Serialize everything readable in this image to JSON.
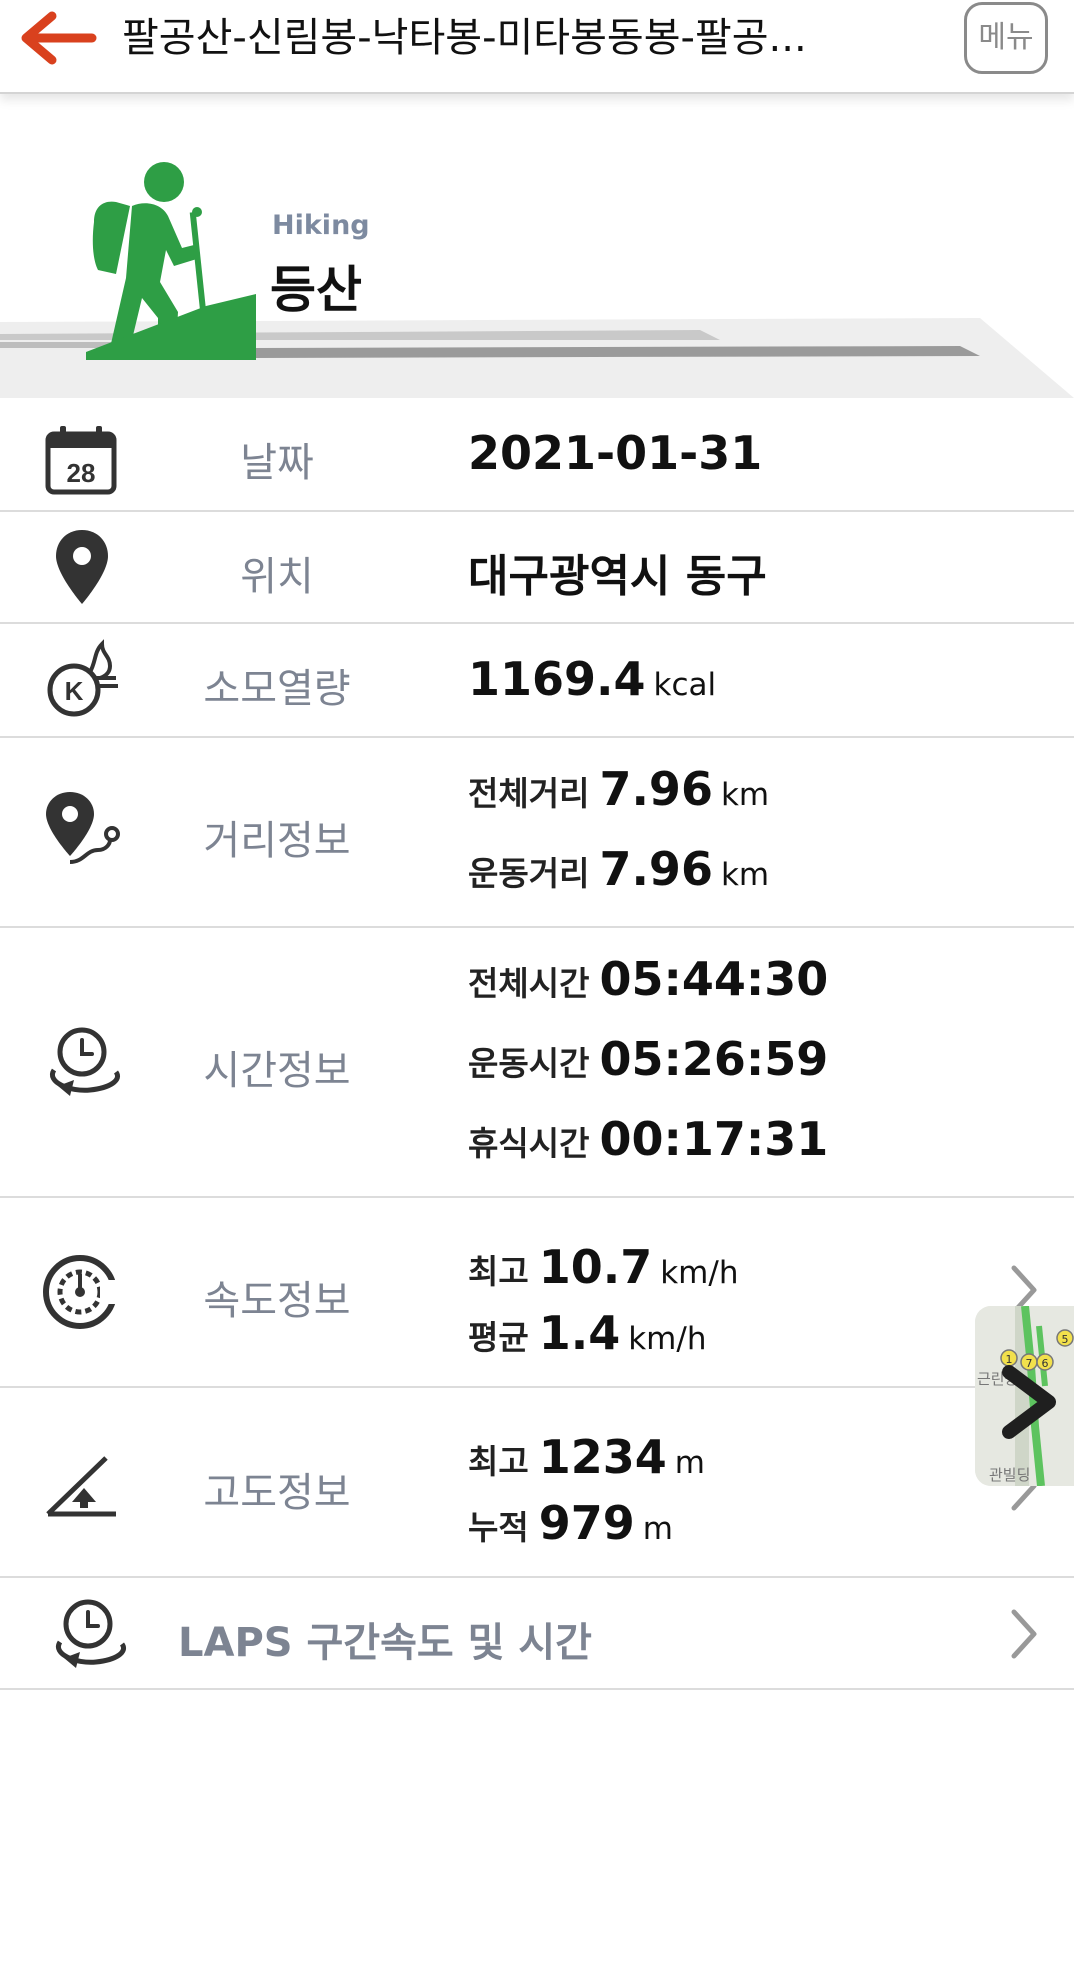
{
  "header": {
    "title": "팔공산-신림봉-낙타봉-미타봉동봉-팔공...",
    "menu_label": "메뉴"
  },
  "activity": {
    "name_en": "Hiking",
    "name_ko": "등산"
  },
  "rows": {
    "date": {
      "label": "날짜",
      "value": "2021-01-31",
      "calendar_day": "28"
    },
    "location": {
      "label": "위치",
      "value": "대구광역시 동구"
    },
    "calories": {
      "label": "소모열량",
      "value": "1169.4",
      "unit": "kcal",
      "icon_letter": "K"
    },
    "distance": {
      "label": "거리정보",
      "total_label": "전체거리",
      "total_value": "7.96",
      "total_unit": "km",
      "moving_label": "운동거리",
      "moving_value": "7.96",
      "moving_unit": "km"
    },
    "time": {
      "label": "시간정보",
      "total_label": "전체시간",
      "total_value": "05:44:30",
      "moving_label": "운동시간",
      "moving_value": "05:26:59",
      "rest_label": "휴식시간",
      "rest_value": "00:17:31"
    },
    "speed": {
      "label": "속도정보",
      "max_label": "최고",
      "max_value": "10.7",
      "max_unit": "km/h",
      "avg_label": "평균",
      "avg_value": "1.4",
      "avg_unit": "km/h"
    },
    "altitude": {
      "label": "고도정보",
      "max_label": "최고",
      "max_value": "1234",
      "max_unit": "m",
      "cum_label": "누적",
      "cum_value": "979",
      "cum_unit": "m"
    },
    "laps": {
      "label": "LAPS 구간속도 및 시간"
    }
  },
  "map_thumb": {
    "text_top": "근린공",
    "text_bottom": "관빌딩",
    "markers": [
      "1",
      "7",
      "6",
      "5"
    ]
  },
  "colors": {
    "accent_back": "#d9411e",
    "hiker_green": "#2e9e45",
    "label_gray": "#7d8492",
    "divider": "#dcdcdc"
  }
}
